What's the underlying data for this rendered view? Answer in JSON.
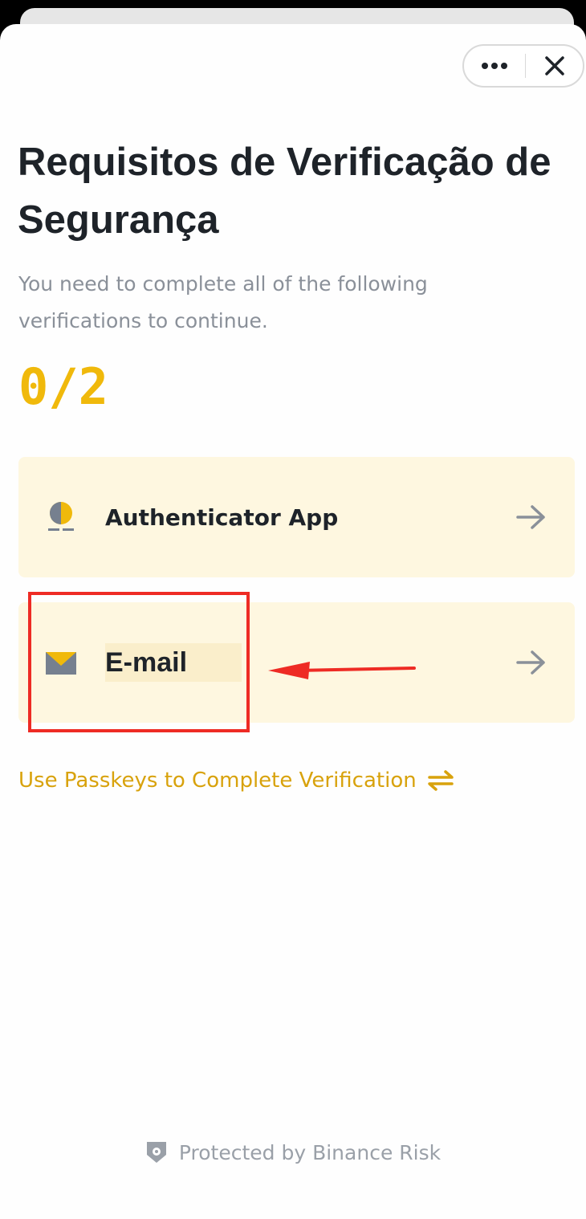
{
  "header": {
    "more_icon": "more-horizontal-icon",
    "close_icon": "close-icon"
  },
  "main": {
    "title": "Requisitos de Verificação de Segurança",
    "subtitle": "You need to complete all of the following verifications to continue.",
    "progress": "0/2"
  },
  "methods": [
    {
      "label": "Authenticator App",
      "icon": "authenticator-icon",
      "arrow_icon": "arrow-right-icon"
    },
    {
      "label": "E-mail",
      "icon": "envelope-icon",
      "arrow_icon": "arrow-right-icon"
    }
  ],
  "passkey": {
    "label": "Use Passkeys to Complete Verification",
    "icon": "swap-arrows-icon"
  },
  "footer": {
    "text": "Protected by Binance Risk",
    "icon": "shield-icon"
  },
  "colors": {
    "accent": "#f0b90b",
    "link": "#d8a20c",
    "card_bg": "#fef7e0",
    "annotation": "#ee2b24",
    "text_primary": "#1e2329",
    "text_secondary": "#8a9099"
  }
}
